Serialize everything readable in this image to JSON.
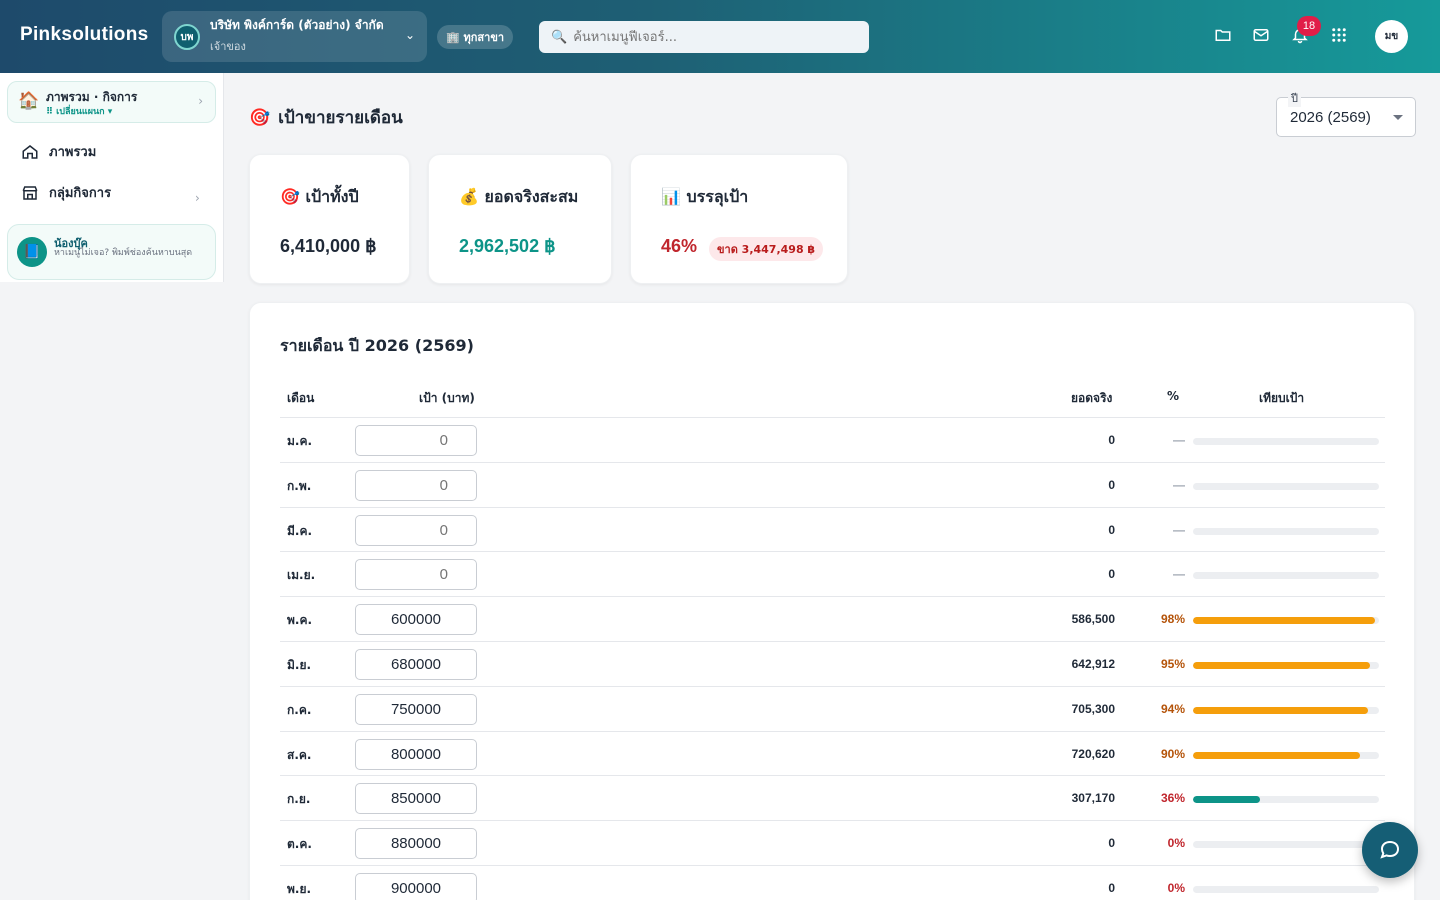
{
  "brand": "Pinksolutions",
  "company": {
    "logo": "บพ",
    "name": "บริษัท พิงค์การ์ด (ตัวอย่าง) จำกัด",
    "role": "เจ้าของ"
  },
  "branch_label": "🏢 ทุกสาขา",
  "search": {
    "placeholder": "ค้นหาเมนูฟีเจอร์..."
  },
  "notifications": {
    "count": "18"
  },
  "user": {
    "initials": "มข"
  },
  "sidebar": {
    "overview_title": "ภาพรวม · กิจการ",
    "overview_sub": "⠿ เปลี่ยนแผนก ▾",
    "items": [
      {
        "label": "ภาพรวม",
        "icon": "home-icon"
      },
      {
        "label": "กลุ่มกิจการ",
        "icon": "store-icon"
      }
    ],
    "helper": {
      "title": "น้องบุ๊ค",
      "text": "หาเมนูไม่เจอ? พิมพ์ช่องค้นหาบนสุด"
    }
  },
  "page": {
    "title": "เป้าขายรายเดือน",
    "year_label": "ปี",
    "year_value": "2026 (2569)"
  },
  "kpis": {
    "target": {
      "label": "เป้าทั้งปี",
      "value": "6,410,000 ฿"
    },
    "actual": {
      "label": "ยอดจริงสะสม",
      "value": "2,962,502 ฿"
    },
    "achieve": {
      "label": "บรรลุเป้า",
      "value": "46%",
      "shortfall": "ขาด 3,447,498 ฿"
    }
  },
  "colors": {
    "teal": "#0d9488",
    "red": "#c0262d",
    "orange": "#f59e0b",
    "topbar_start": "#1e4a6b",
    "topbar_end": "#169a9a"
  },
  "table": {
    "title": "รายเดือน ปี 2026 (2569)",
    "headers": {
      "month": "เดือน",
      "target": "เป้า (บาท)",
      "actual": "ยอดจริง",
      "pct": "%",
      "compare": "เทียบเป้า"
    },
    "rows": [
      {
        "month": "ม.ค.",
        "target": "",
        "placeholder": "0",
        "actual": "0",
        "pct": "—",
        "ratio": 0
      },
      {
        "month": "ก.พ.",
        "target": "",
        "placeholder": "0",
        "actual": "0",
        "pct": "—",
        "ratio": 0
      },
      {
        "month": "มี.ค.",
        "target": "",
        "placeholder": "0",
        "actual": "0",
        "pct": "—",
        "ratio": 0
      },
      {
        "month": "เม.ย.",
        "target": "",
        "placeholder": "0",
        "actual": "0",
        "pct": "—",
        "ratio": 0
      },
      {
        "month": "พ.ค.",
        "target": "600000",
        "placeholder": "0",
        "actual": "586,500",
        "pct": "98%",
        "ratio": 0.98
      },
      {
        "month": "มิ.ย.",
        "target": "680000",
        "placeholder": "0",
        "actual": "642,912",
        "pct": "95%",
        "ratio": 0.95
      },
      {
        "month": "ก.ค.",
        "target": "750000",
        "placeholder": "0",
        "actual": "705,300",
        "pct": "94%",
        "ratio": 0.94
      },
      {
        "month": "ส.ค.",
        "target": "800000",
        "placeholder": "0",
        "actual": "720,620",
        "pct": "90%",
        "ratio": 0.9
      },
      {
        "month": "ก.ย.",
        "target": "850000",
        "placeholder": "0",
        "actual": "307,170",
        "pct": "36%",
        "ratio": 0.36
      },
      {
        "month": "ต.ค.",
        "target": "880000",
        "placeholder": "0",
        "actual": "0",
        "pct": "0%",
        "ratio": 0
      },
      {
        "month": "พ.ย.",
        "target": "900000",
        "placeholder": "0",
        "actual": "0",
        "pct": "0%",
        "ratio": 0
      }
    ]
  }
}
